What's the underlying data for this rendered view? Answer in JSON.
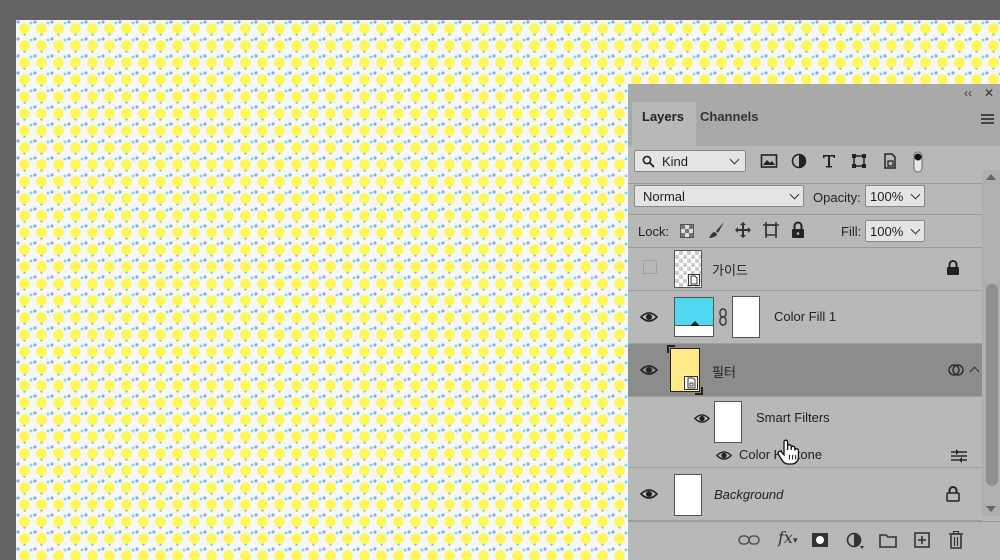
{
  "panel": {
    "tabs": [
      {
        "label": "Layers",
        "active": true
      },
      {
        "label": "Channels",
        "active": false
      }
    ],
    "top_buttons": {
      "collapse": "‹‹",
      "close": "✕"
    }
  },
  "filter": {
    "kind_label": "Kind",
    "kind_icon": "search-icon"
  },
  "blend": {
    "mode": "Normal",
    "opacity_label": "Opacity:",
    "opacity_value": "100%"
  },
  "lock": {
    "label": "Lock:",
    "fill_label": "Fill:",
    "fill_value": "100%"
  },
  "layers": [
    {
      "name": "가이드",
      "visible": false,
      "locked": true
    },
    {
      "name": "Color Fill 1",
      "visible": true,
      "fill_color": "#4fd8ef"
    },
    {
      "name": "필터",
      "visible": true,
      "selected": true,
      "smart_object": true
    },
    {
      "name": "Smart Filters",
      "visible": true,
      "sub": true
    },
    {
      "name": "Color Halftone",
      "visible": true,
      "sub": true
    },
    {
      "name": "Background",
      "visible": true,
      "italic": true,
      "locked": true
    }
  ],
  "colors": {
    "halftone_yellow": "#fff75a",
    "halftone_blue": "#8fa6ea",
    "halftone_cyan": "#68e0e8",
    "selected_layer": "#8c8c8c",
    "panel_bg": "#b8b8b8"
  }
}
